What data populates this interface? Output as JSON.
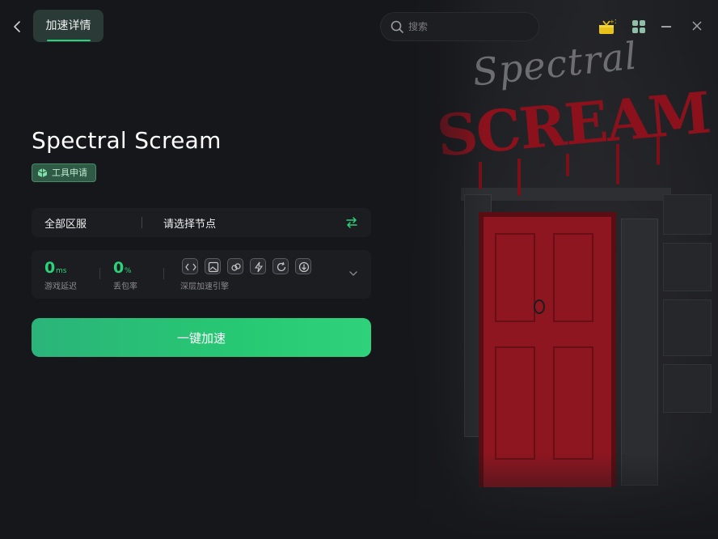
{
  "header": {
    "tab_label": "加速详情",
    "search_placeholder": "搜索"
  },
  "game": {
    "title": "Spectral Scream",
    "badge": "工具申请",
    "art_title_line1": "Spectral",
    "art_title_line2": "SCREAM"
  },
  "region": {
    "server_label": "全部区服",
    "node_label": "请选择节点"
  },
  "stats": {
    "latency_value": "0",
    "latency_unit": "ms",
    "latency_label": "游戏延迟",
    "loss_value": "0",
    "loss_unit": "%",
    "loss_label": "丢包率",
    "engine_label": "深层加速引擎"
  },
  "action": {
    "accelerate_label": "一键加速"
  },
  "colors": {
    "accent": "#2bd27a",
    "background": "#16171b",
    "door_red": "#8e1620"
  },
  "icons": [
    "back-icon",
    "search-icon",
    "gift-icon",
    "apps-icon",
    "minimize-icon",
    "close-icon",
    "tool-icon",
    "swap-icon",
    "chevron-down-icon"
  ]
}
